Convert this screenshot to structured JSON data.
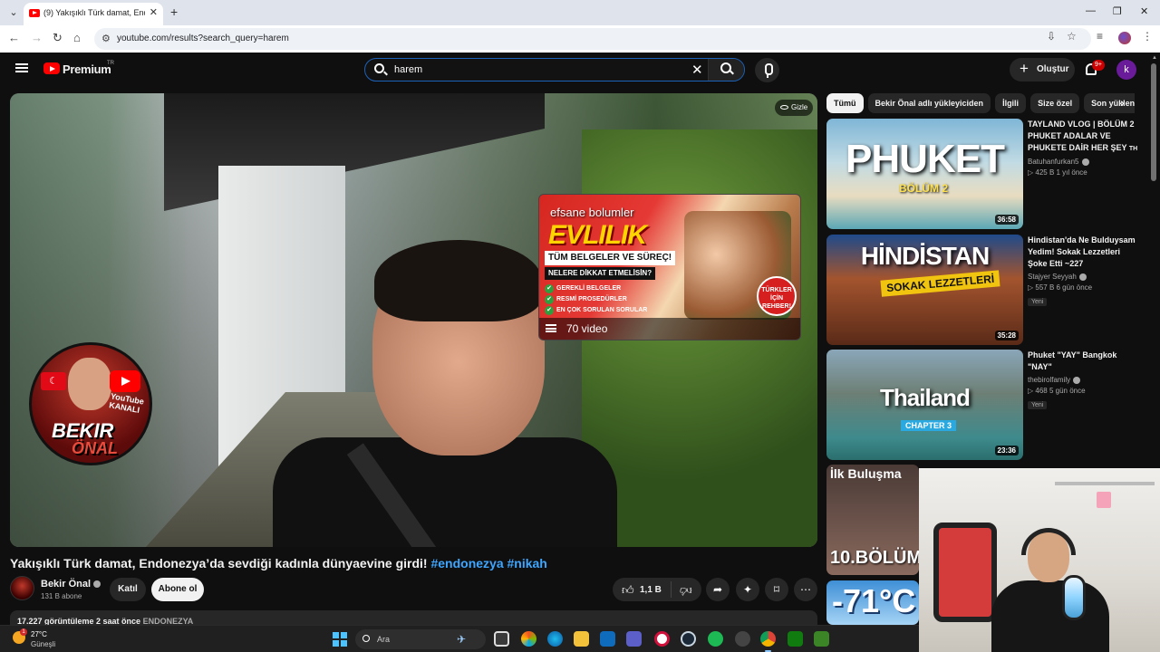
{
  "browser": {
    "tab_title": "(9) Yakışıklı Türk damat, Endone...",
    "tab_close": "✕",
    "new_tab": "+",
    "url": "youtube.com/results?search_query=harem",
    "window_controls": [
      "—",
      "❐",
      "✕"
    ]
  },
  "header": {
    "brand": "Premium",
    "brand_suffix": "TR",
    "search_query": "harem",
    "create_label": "Oluştur",
    "notifications_badge": "9+",
    "avatar_letter": "k"
  },
  "player": {
    "hide_label": "Gizle",
    "channel_badge": {
      "line1": "BEKIR",
      "line2": "ÖNAL",
      "yt": "YouTube KANALI"
    },
    "endcard": {
      "label": "efsane bolumler",
      "headline": "EVLILIK",
      "sub": "TÜM BELGELER VE SÜREÇ!",
      "warning": "NELERE DİKKAT ETMELİSİN?",
      "checks": [
        "GEREKLİ BELGELER",
        "RESMİ PROSEDÜRLER",
        "EN ÇOK SORULAN SORULAR"
      ],
      "stamp": "TÜRKLER İÇİN REHBER!",
      "count": "70 video"
    }
  },
  "video": {
    "title": "Yakışıklı Türk damat, Endonezya’da sevdiği kadınla dünyaevine girdi!",
    "hashtags": "#endonezya #nikah",
    "channel_name": "Bekir Önal",
    "subscribers": "131 B abone",
    "join_label": "Katıl",
    "subscribe_label": "Abone ol",
    "likes": "1,1 B",
    "stats": "17.227 görüntüleme  2 saat önce",
    "stats_tag": "ENDONEZYA"
  },
  "chips": [
    "Tümü",
    "Bekir Önal adlı yükleyiciden",
    "İlgili",
    "Size özel",
    "Son yüklenenler"
  ],
  "recommendations": [
    {
      "thumb_text": "PHUKET",
      "thumb_sub": "BÖLÜM 2",
      "duration": "36:58",
      "title": "TAYLAND VLOG | BÖLÜM 2 PHUKET ADALAR VE PHUKETE DAİR HER ŞEY",
      "title_suffix": "TH",
      "channel": "Batuhanfurkan5",
      "meta": "▷ 425 B  1 yıl önce",
      "badge": ""
    },
    {
      "thumb_text": "HİNDİSTAN",
      "thumb_sub": "SOKAK LEZZETLERİ",
      "duration": "35:28",
      "title": "Hindistan'da Ne Bulduysam Yedim! Sokak Lezzetleri Şoke Etti ~227",
      "title_suffix": "",
      "channel": "Stajyer Seyyah",
      "meta": "▷ 557 B  6 gün önce",
      "badge": "Yeni"
    },
    {
      "thumb_text": "Thailand",
      "thumb_sub": "CHAPTER 3",
      "duration": "23:36",
      "title": "Phuket \"YAY\" Bangkok \"NAY\"",
      "title_suffix": "",
      "channel": "thebirolfamily",
      "meta": "▷ 468  5 gün önce",
      "badge": "Yeni"
    },
    {
      "thumb_text": "İlk Buluşma",
      "thumb_sub": "10.BÖLÜM",
      "duration": "",
      "title": "",
      "title_suffix": "",
      "channel": "",
      "meta": "",
      "badge": ""
    },
    {
      "thumb_text": "-71°C",
      "thumb_sub": "",
      "duration": "",
      "title": "",
      "title_suffix": "",
      "channel": "",
      "meta": "",
      "badge": ""
    }
  ],
  "taskbar": {
    "weather_temp": "27°C",
    "weather_cond": "Güneşli",
    "weather_badge": "1",
    "search_label": "Ara"
  },
  "colors": {
    "accent_red": "#ff0000",
    "link_blue": "#3ea6ff",
    "bg": "#0f0f0f"
  }
}
